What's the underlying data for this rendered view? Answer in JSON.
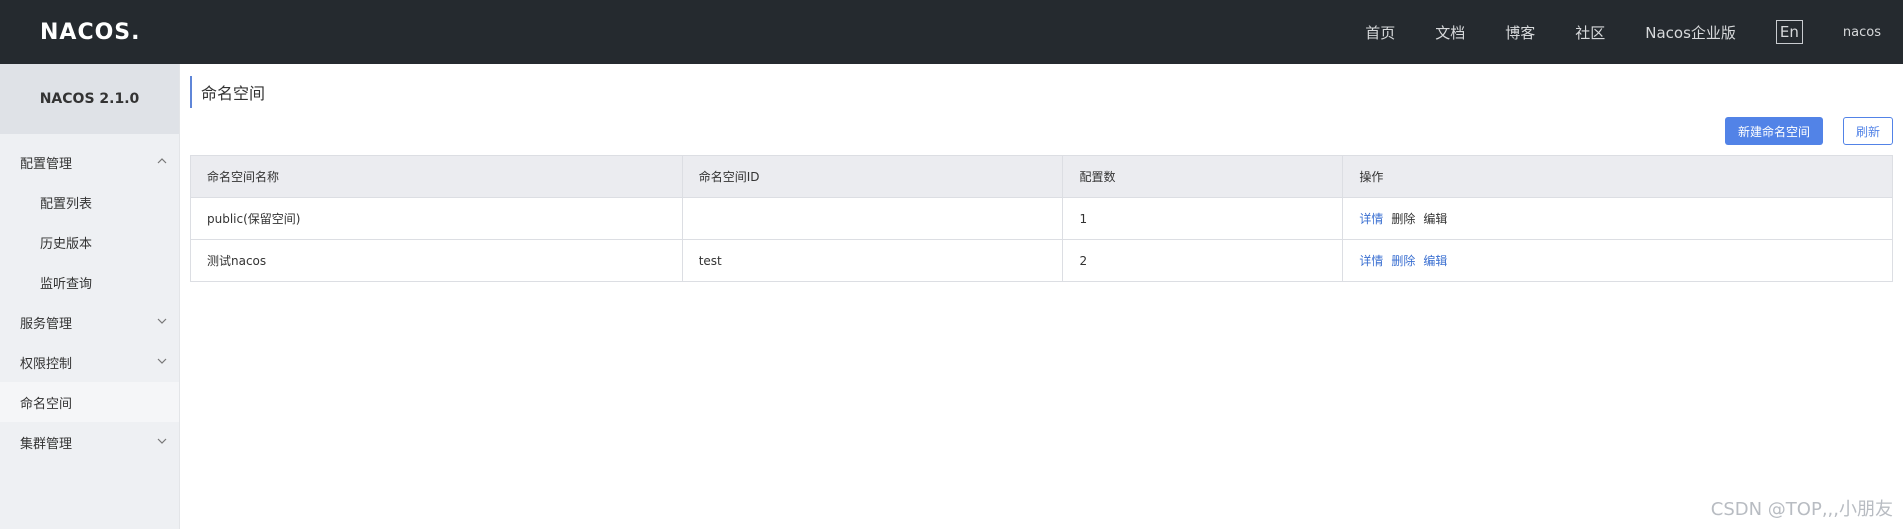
{
  "header": {
    "logo": "NACOS",
    "nav": [
      "首页",
      "文档",
      "博客",
      "社区",
      "Nacos企业版"
    ],
    "lang": "En",
    "user": "nacos"
  },
  "sidebar": {
    "version": "NACOS 2.1.0",
    "items": [
      {
        "label": "配置管理",
        "sub": false,
        "chevron": "up"
      },
      {
        "label": "配置列表",
        "sub": true,
        "chevron": ""
      },
      {
        "label": "历史版本",
        "sub": true,
        "chevron": ""
      },
      {
        "label": "监听查询",
        "sub": true,
        "chevron": ""
      },
      {
        "label": "服务管理",
        "sub": false,
        "chevron": "down"
      },
      {
        "label": "权限控制",
        "sub": false,
        "chevron": "down"
      },
      {
        "label": "命名空间",
        "sub": false,
        "chevron": "",
        "active": true
      },
      {
        "label": "集群管理",
        "sub": false,
        "chevron": "down"
      }
    ]
  },
  "main": {
    "title": "命名空间",
    "create_button": "新建命名空间",
    "refresh_button": "刷新",
    "table": {
      "headers": [
        "命名空间名称",
        "命名空间ID",
        "配置数",
        "操作"
      ],
      "rows": [
        {
          "name": "public(保留空间)",
          "id": "",
          "count": "1",
          "ops": [
            "详情",
            "删除",
            "编辑"
          ],
          "enabled": [
            true,
            false,
            false
          ]
        },
        {
          "name": "测试nacos",
          "id": "test",
          "count": "2",
          "ops": [
            "详情",
            "删除",
            "编辑"
          ],
          "enabled": [
            true,
            true,
            true
          ]
        }
      ]
    }
  },
  "watermark": "CSDN @TOP,,,小朋友",
  "colors": {
    "topbar": "#252a2f",
    "primary": "#5283e7",
    "link": "#3a6fd1"
  }
}
